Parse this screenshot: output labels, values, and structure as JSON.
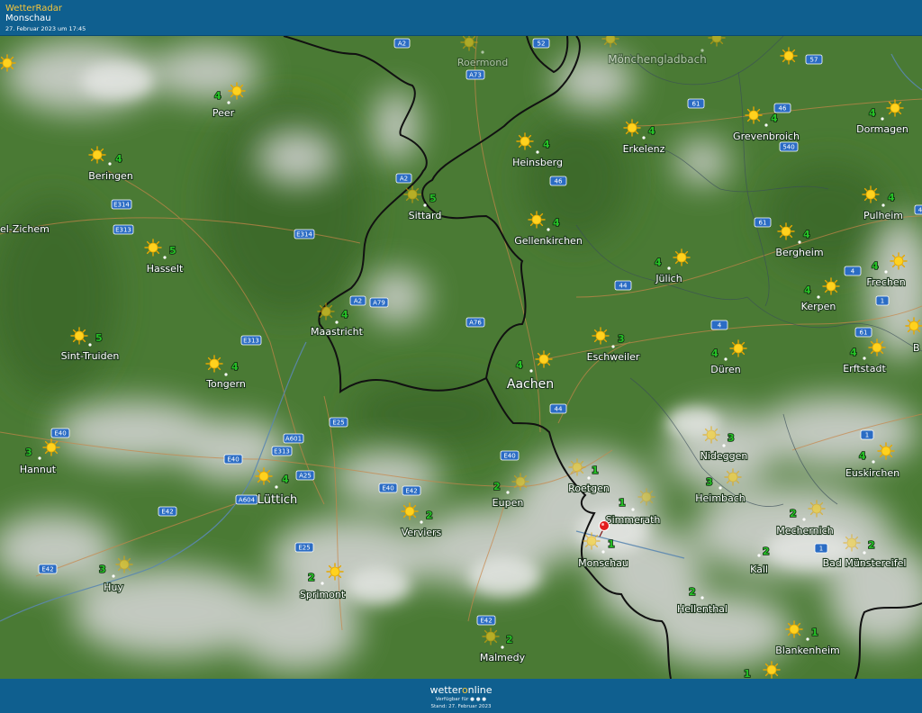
{
  "header": {
    "app_title": "WetterRadar",
    "location": "Monschau",
    "timestamp": "27. Februar 2023 um 17:45"
  },
  "footer": {
    "brand_pre": "wetter",
    "brand_o": "o",
    "brand_post": "nline",
    "available": "Verfügbar für",
    "stand": "Stand: 27. Februar 2023"
  },
  "colors": {
    "header_bg": "#0f5f8f",
    "accent_yellow": "#f7c63a",
    "forecast_green": "#26c026",
    "marker_red": "#e21d1d",
    "map_green": "#4a7a34",
    "cloud_grey": "#c9cdc9"
  },
  "icons": {
    "sun": "sun-icon",
    "pin": "location-pin-icon"
  },
  "towns": [
    {
      "name": "Peer",
      "value": "4"
    },
    {
      "name": "Beringen",
      "value": "4"
    },
    {
      "name": "el-Zichem",
      "value": ""
    },
    {
      "name": "Hasselt",
      "value": "5"
    },
    {
      "name": "Sint-Truiden",
      "value": "5"
    },
    {
      "name": "Tongern",
      "value": "4"
    },
    {
      "name": "Hannut",
      "value": "3"
    },
    {
      "name": "Huy",
      "value": "3"
    },
    {
      "name": "Lüttich",
      "value": "4"
    },
    {
      "name": "Sprimont",
      "value": "2"
    },
    {
      "name": "Verviers",
      "value": "2"
    },
    {
      "name": "Maastricht",
      "value": "4"
    },
    {
      "name": "Sittard",
      "value": "5"
    },
    {
      "name": "Roermond",
      "value": ""
    },
    {
      "name": "Heinsberg",
      "value": "4"
    },
    {
      "name": "Gellenkirchen",
      "value": "4"
    },
    {
      "name": "Erkelenz",
      "value": "4"
    },
    {
      "name": "Mönchengladbach",
      "value": ""
    },
    {
      "name": "Grevenbroich",
      "value": "4"
    },
    {
      "name": "Dormagen",
      "value": "4"
    },
    {
      "name": "Pulheim",
      "value": "4"
    },
    {
      "name": "Bergheim",
      "value": "4"
    },
    {
      "name": "Frechen",
      "value": "4"
    },
    {
      "name": "Kerpen",
      "value": "4"
    },
    {
      "name": "Jülich",
      "value": "4"
    },
    {
      "name": "Aachen",
      "value": "4"
    },
    {
      "name": "Eschweiler",
      "value": "3"
    },
    {
      "name": "Düren",
      "value": "4"
    },
    {
      "name": "Erftstadt",
      "value": "4"
    },
    {
      "name": "Nideggen",
      "value": "3"
    },
    {
      "name": "Euskirchen",
      "value": "4"
    },
    {
      "name": "Heimbach",
      "value": "3"
    },
    {
      "name": "Roetgen",
      "value": "1"
    },
    {
      "name": "Eupen",
      "value": "2"
    },
    {
      "name": "Simmerath",
      "value": "1"
    },
    {
      "name": "Monschau",
      "value": "1"
    },
    {
      "name": "Mechernich",
      "value": "2"
    },
    {
      "name": "Kall",
      "value": "2"
    },
    {
      "name": "Bad Münstereifel",
      "value": "2"
    },
    {
      "name": "Hellenthal",
      "value": "2"
    },
    {
      "name": "Blankenheim",
      "value": "1"
    },
    {
      "name": "Malmedy",
      "value": "2"
    },
    {
      "name": "B",
      "value": ""
    }
  ],
  "extra_values": [
    "1"
  ],
  "roads": [
    "A2",
    "A73",
    "52",
    "57",
    "61",
    "46",
    "540",
    "A2",
    "46",
    "61",
    "4",
    "E314",
    "E313",
    "E314",
    "A2",
    "A79",
    "A76",
    "44",
    "E313",
    "4",
    "61",
    "4",
    "1",
    "E25",
    "44",
    "E40",
    "A601",
    "E40",
    "E313",
    "A25",
    "E40",
    "A604",
    "E40",
    "E42",
    "E42",
    "E25",
    "E42",
    "E42",
    "1",
    "1"
  ]
}
